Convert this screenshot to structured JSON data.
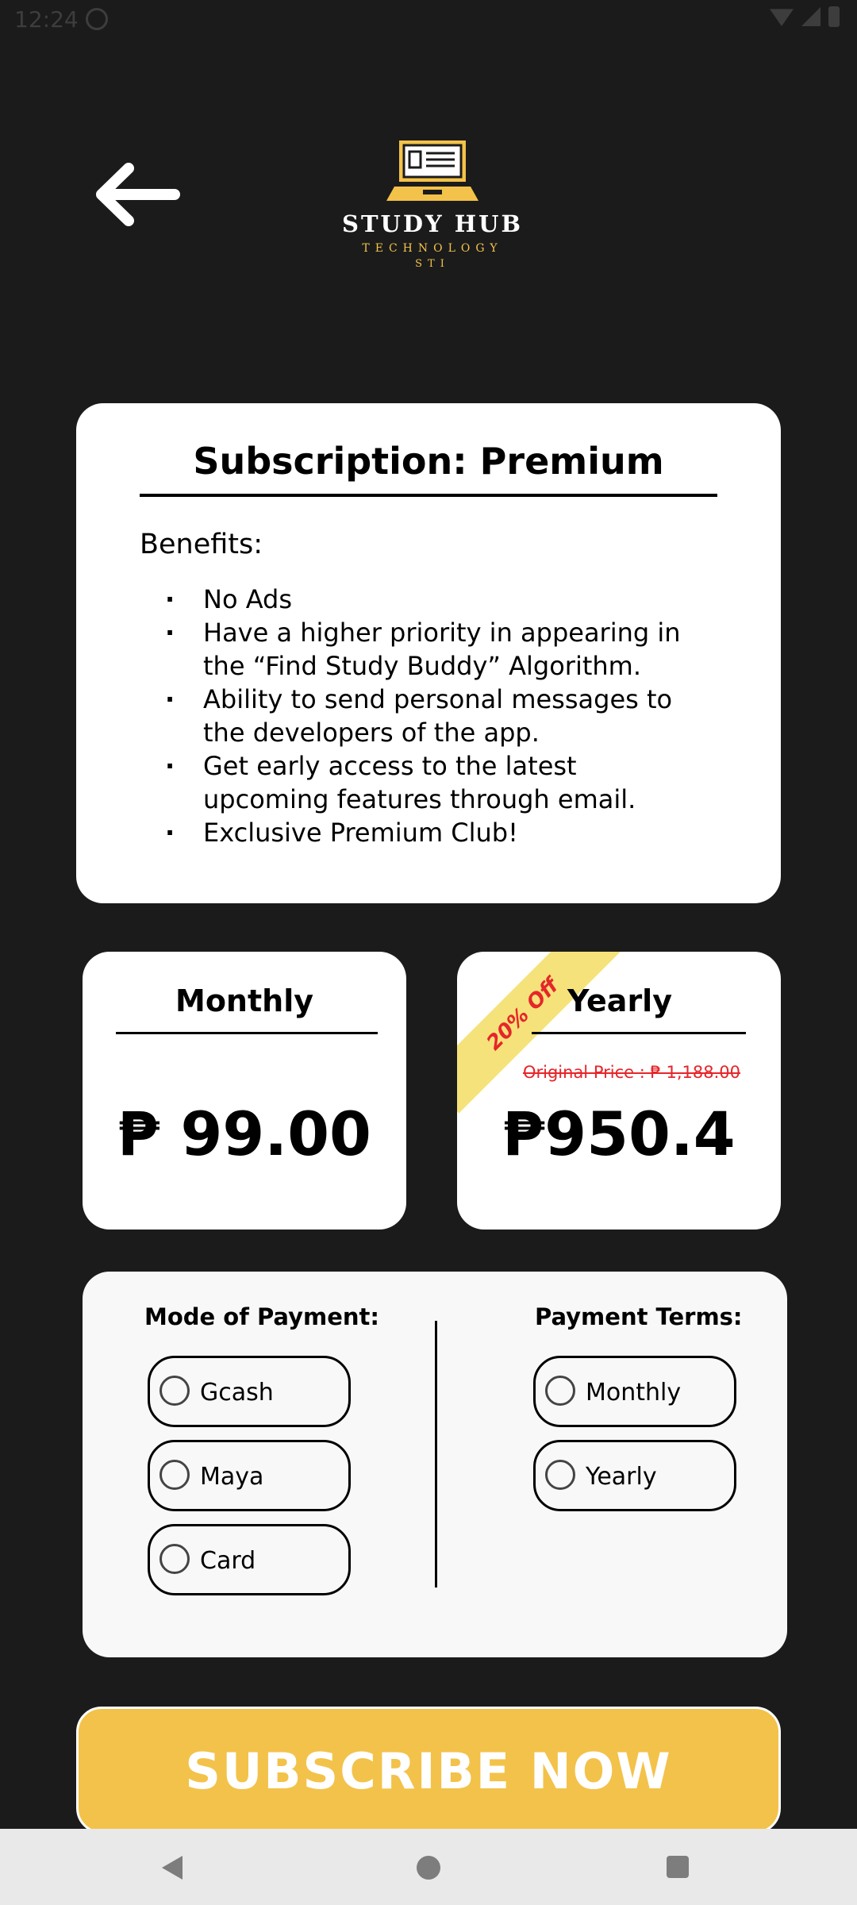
{
  "status_bar": {
    "time": "12:24"
  },
  "header": {
    "back_icon": "arrow-left-icon",
    "logo": {
      "title": "STUDY HUB",
      "subtitle": "TECHNOLOGY",
      "subtitle2": "STI"
    }
  },
  "subscription": {
    "title": "Subscription: Premium",
    "benefits_label": "Benefits:",
    "benefits": [
      "No Ads",
      "Have a higher priority in appearing in the “Find Study Buddy” Algorithm.",
      " Ability to send personal messages to the developers of the app.",
      "Get early access to the latest upcoming features through email.",
      "Exclusive Premium Club!"
    ]
  },
  "plans": {
    "monthly": {
      "name": "Monthly",
      "price": "₱ 99.00"
    },
    "yearly": {
      "name": "Yearly",
      "ribbon": "20% Off",
      "original_price": "Original Price : ₱ 1,188.00",
      "price": "₱950.4"
    }
  },
  "payment": {
    "mode_heading": "Mode of Payment:",
    "mode_options": [
      "Gcash",
      "Maya",
      "Card"
    ],
    "terms_heading": "Payment Terms:",
    "terms_options": [
      "Monthly",
      "Yearly"
    ]
  },
  "subscribe_button": {
    "label": "SUBSCRIBE NOW"
  },
  "colors": {
    "background": "#1b1b1b",
    "accent": "#f3c24a",
    "discount_red": "#e5262a",
    "ribbon": "#f6e27a"
  }
}
